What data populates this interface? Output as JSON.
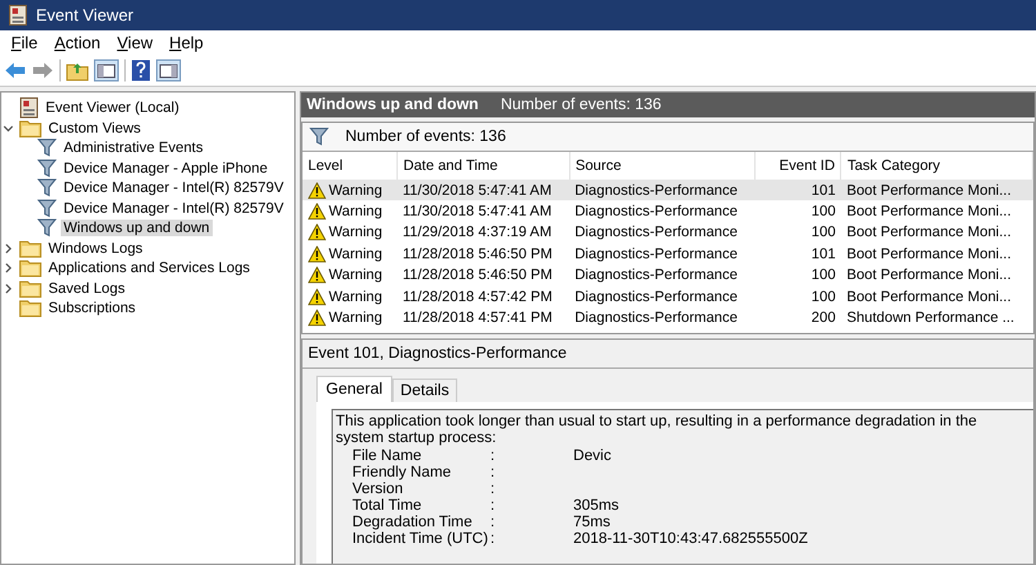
{
  "window": {
    "title": "Event Viewer"
  },
  "menu": [
    "File",
    "Action",
    "View",
    "Help"
  ],
  "tree": [
    {
      "label": "Event Viewer (Local)",
      "kind": "computer",
      "selected": false
    },
    {
      "label": "Custom Views",
      "kind": "folder",
      "expanded": true,
      "selected": false,
      "children": [
        {
          "label": "Administrative Events",
          "kind": "filter",
          "selected": false
        },
        {
          "label": "Device Manager - Apple iPhone",
          "kind": "filter",
          "selected": false
        },
        {
          "label": "Device Manager - Intel(R) 82579V",
          "kind": "filter",
          "selected": false
        },
        {
          "label": "Device Manager - Intel(R) 82579V",
          "kind": "filter",
          "selected": false
        },
        {
          "label": "Windows up and down",
          "kind": "filter",
          "selected": true
        }
      ]
    },
    {
      "label": "Windows Logs",
      "kind": "folder",
      "expanded": false,
      "selected": false
    },
    {
      "label": "Applications and Services Logs",
      "kind": "folder",
      "expanded": false,
      "selected": false
    },
    {
      "label": "Saved Logs",
      "kind": "folder",
      "expanded": false,
      "selected": false
    },
    {
      "label": "Subscriptions",
      "kind": "folder",
      "selected": false
    }
  ],
  "events_pane": {
    "title": "Windows up and down",
    "count": "Number of events: 136",
    "filter_text": "Number of events: 136",
    "columns": [
      "Level",
      "Date and Time",
      "Source",
      "Event ID",
      "Task Category"
    ],
    "rows": [
      {
        "selected": true,
        "level": "Warning",
        "date": "11/30/2018 5:47:41 AM",
        "source": "Diagnostics-Performance",
        "event_id": "101",
        "task_category": "Boot Performance Moni..."
      },
      {
        "selected": false,
        "level": "Warning",
        "date": "11/30/2018 5:47:41 AM",
        "source": "Diagnostics-Performance",
        "event_id": "100",
        "task_category": "Boot Performance Moni..."
      },
      {
        "selected": false,
        "level": "Warning",
        "date": "11/29/2018 4:37:19 AM",
        "source": "Diagnostics-Performance",
        "event_id": "100",
        "task_category": "Boot Performance Moni..."
      },
      {
        "selected": false,
        "level": "Warning",
        "date": "11/28/2018 5:46:50 PM",
        "source": "Diagnostics-Performance",
        "event_id": "101",
        "task_category": "Boot Performance Moni..."
      },
      {
        "selected": false,
        "level": "Warning",
        "date": "11/28/2018 5:46:50 PM",
        "source": "Diagnostics-Performance",
        "event_id": "100",
        "task_category": "Boot Performance Moni..."
      },
      {
        "selected": false,
        "level": "Warning",
        "date": "11/28/2018 4:57:42 PM",
        "source": "Diagnostics-Performance",
        "event_id": "100",
        "task_category": "Boot Performance Moni..."
      },
      {
        "selected": false,
        "level": "Warning",
        "date": "11/28/2018 4:57:41 PM",
        "source": "Diagnostics-Performance",
        "event_id": "200",
        "task_category": "Shutdown Performance ..."
      }
    ]
  },
  "detail": {
    "title": "Event 101, Diagnostics-Performance",
    "tabs": [
      {
        "label": "General",
        "selected": true
      },
      {
        "label": "Details",
        "selected": false
      }
    ],
    "description": "This application took longer than usual to start up, resulting in a performance degradation in the system startup process:",
    "fields": [
      {
        "name": "File Name",
        "separator": ":",
        "value": "Devic"
      },
      {
        "name": "Friendly Name",
        "separator": ":"
      },
      {
        "name": "Version",
        "separator": ":"
      },
      {
        "name": "Total Time",
        "separator": ":",
        "value": "305ms"
      },
      {
        "name": "Degradation Time",
        "separator": ":",
        "value": "75ms"
      },
      {
        "name": "Incident Time (UTC)",
        "separator": ":",
        "value": "2018-11-30T10:43:47.682555500Z"
      }
    ]
  }
}
